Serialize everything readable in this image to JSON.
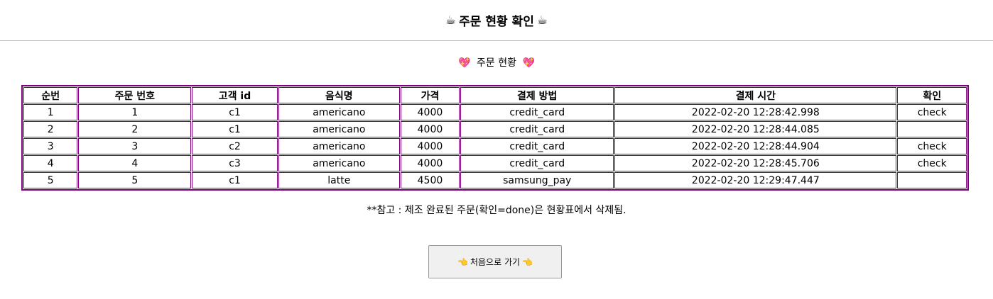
{
  "header": {
    "title": "주문 현황 확인",
    "icon_left": "☕",
    "icon_right": "☕"
  },
  "section": {
    "title": "주문 현황",
    "icon_left": "💖",
    "icon_right": "💖"
  },
  "table": {
    "columns": [
      "순번",
      "주문 번호",
      "고객 id",
      "음식명",
      "가격",
      "결제 방법",
      "결제 시간",
      "확인"
    ],
    "rows": [
      [
        "1",
        "1",
        "c1",
        "americano",
        "4000",
        "credit_card",
        "2022-02-20 12:28:42.998",
        "check"
      ],
      [
        "2",
        "2",
        "c1",
        "americano",
        "4000",
        "credit_card",
        "2022-02-20 12:28:44.085",
        ""
      ],
      [
        "3",
        "3",
        "c2",
        "americano",
        "4000",
        "credit_card",
        "2022-02-20 12:28:44.904",
        "check"
      ],
      [
        "4",
        "4",
        "c3",
        "americano",
        "4000",
        "credit_card",
        "2022-02-20 12:28:45.706",
        "check"
      ],
      [
        "5",
        "5",
        "c1",
        "latte",
        "4500",
        "samsung_pay",
        "2022-02-20 12:29:47.447",
        ""
      ]
    ]
  },
  "note": "**참고 : 제조 완료된 주문(확인=done)은 현황표에서 삭제됨.",
  "home_button": {
    "label": "처음으로 가기",
    "icon_left": "👈",
    "icon_right": "👈"
  },
  "colors": {
    "table_border": "#800080",
    "button_bg": "#f0f0f0"
  }
}
